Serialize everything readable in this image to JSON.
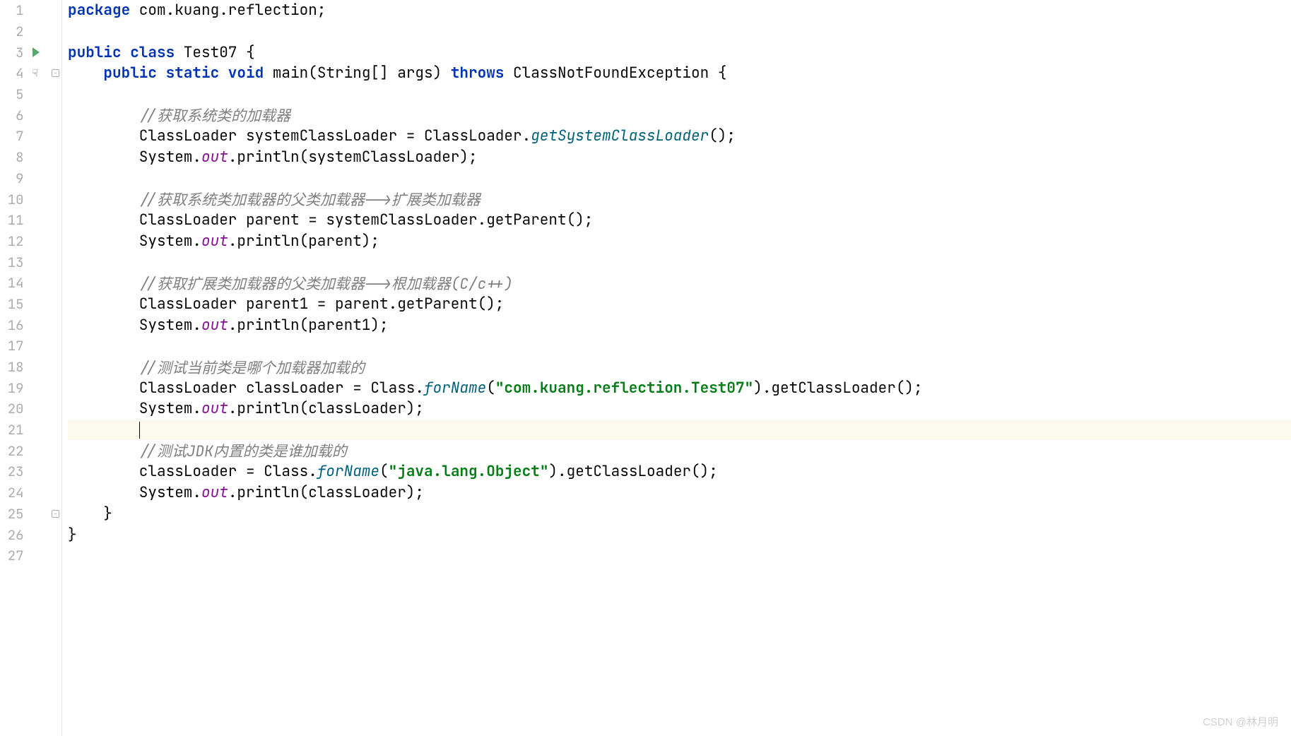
{
  "watermark": "CSDN @林月明",
  "lines": [
    {
      "num": "1",
      "icons": [],
      "tokens": [
        {
          "cls": "kw",
          "t": "package"
        },
        {
          "cls": "plain",
          "t": " com.kuang.reflection;"
        }
      ]
    },
    {
      "num": "2",
      "icons": [],
      "tokens": []
    },
    {
      "num": "3",
      "icons": [
        "run"
      ],
      "tokens": [
        {
          "cls": "kw",
          "t": "public class"
        },
        {
          "cls": "plain",
          "t": " Test07 {"
        }
      ]
    },
    {
      "num": "4",
      "icons": [
        "cursor",
        "fold"
      ],
      "tokens": [
        {
          "cls": "plain",
          "t": "    "
        },
        {
          "cls": "kw",
          "t": "public static void"
        },
        {
          "cls": "plain",
          "t": " main(String[] args) "
        },
        {
          "cls": "kw",
          "t": "throws"
        },
        {
          "cls": "plain",
          "t": " ClassNotFoundException {"
        }
      ]
    },
    {
      "num": "5",
      "icons": [],
      "tokens": []
    },
    {
      "num": "6",
      "icons": [],
      "tokens": [
        {
          "cls": "plain",
          "t": "        "
        },
        {
          "cls": "comment-text",
          "t": "//获取系统类的加载器"
        }
      ]
    },
    {
      "num": "7",
      "icons": [],
      "tokens": [
        {
          "cls": "plain",
          "t": "        ClassLoader systemClassLoader = ClassLoader."
        },
        {
          "cls": "method-static",
          "t": "getSystemClassLoader"
        },
        {
          "cls": "plain",
          "t": "();"
        }
      ]
    },
    {
      "num": "8",
      "icons": [],
      "tokens": [
        {
          "cls": "plain",
          "t": "        System."
        },
        {
          "cls": "field",
          "t": "out"
        },
        {
          "cls": "plain",
          "t": ".println(systemClassLoader);"
        }
      ]
    },
    {
      "num": "9",
      "icons": [],
      "tokens": []
    },
    {
      "num": "10",
      "icons": [],
      "tokens": [
        {
          "cls": "plain",
          "t": "        "
        },
        {
          "cls": "comment-text",
          "t": "//获取系统类加载器的父类加载器-->扩展类加载器"
        }
      ]
    },
    {
      "num": "11",
      "icons": [],
      "tokens": [
        {
          "cls": "plain",
          "t": "        ClassLoader parent = systemClassLoader.getParent();"
        }
      ]
    },
    {
      "num": "12",
      "icons": [],
      "tokens": [
        {
          "cls": "plain",
          "t": "        System."
        },
        {
          "cls": "field",
          "t": "out"
        },
        {
          "cls": "plain",
          "t": ".println(parent);"
        }
      ]
    },
    {
      "num": "13",
      "icons": [],
      "tokens": []
    },
    {
      "num": "14",
      "icons": [],
      "tokens": [
        {
          "cls": "plain",
          "t": "        "
        },
        {
          "cls": "comment-text",
          "t": "//获取扩展类加载器的父类加载器-->根加载器(C/c++)"
        }
      ]
    },
    {
      "num": "15",
      "icons": [],
      "tokens": [
        {
          "cls": "plain",
          "t": "        ClassLoader parent1 = parent.getParent();"
        }
      ]
    },
    {
      "num": "16",
      "icons": [],
      "tokens": [
        {
          "cls": "plain",
          "t": "        System."
        },
        {
          "cls": "field",
          "t": "out"
        },
        {
          "cls": "plain",
          "t": ".println(parent1);"
        }
      ]
    },
    {
      "num": "17",
      "icons": [],
      "tokens": []
    },
    {
      "num": "18",
      "icons": [],
      "tokens": [
        {
          "cls": "plain",
          "t": "        "
        },
        {
          "cls": "comment-text",
          "t": "//测试当前类是哪个加载器加载的"
        }
      ]
    },
    {
      "num": "19",
      "icons": [],
      "tokens": [
        {
          "cls": "plain",
          "t": "        ClassLoader classLoader = Class."
        },
        {
          "cls": "method-static",
          "t": "forName"
        },
        {
          "cls": "plain",
          "t": "("
        },
        {
          "cls": "string",
          "t": "\"com.kuang.reflection.Test07\""
        },
        {
          "cls": "plain",
          "t": ").getClassLoader();"
        }
      ]
    },
    {
      "num": "20",
      "icons": [],
      "tokens": [
        {
          "cls": "plain",
          "t": "        System."
        },
        {
          "cls": "field",
          "t": "out"
        },
        {
          "cls": "plain",
          "t": ".println(classLoader);"
        }
      ]
    },
    {
      "num": "21",
      "icons": [],
      "highlighted": true,
      "tokens": [
        {
          "cls": "plain",
          "t": "        "
        },
        {
          "cls": "caret",
          "t": ""
        }
      ]
    },
    {
      "num": "22",
      "icons": [],
      "tokens": [
        {
          "cls": "plain",
          "t": "        "
        },
        {
          "cls": "comment-text",
          "t": "//测试JDK内置的类是谁加载的"
        }
      ]
    },
    {
      "num": "23",
      "icons": [],
      "tokens": [
        {
          "cls": "plain",
          "t": "        classLoader = Class."
        },
        {
          "cls": "method-static",
          "t": "forName"
        },
        {
          "cls": "plain",
          "t": "("
        },
        {
          "cls": "string",
          "t": "\"java.lang.Object\""
        },
        {
          "cls": "plain",
          "t": ").getClassLoader();"
        }
      ]
    },
    {
      "num": "24",
      "icons": [],
      "tokens": [
        {
          "cls": "plain",
          "t": "        System."
        },
        {
          "cls": "field",
          "t": "out"
        },
        {
          "cls": "plain",
          "t": ".println(classLoader);"
        }
      ]
    },
    {
      "num": "25",
      "icons": [
        "fold"
      ],
      "tokens": [
        {
          "cls": "plain",
          "t": "    }"
        }
      ]
    },
    {
      "num": "26",
      "icons": [],
      "tokens": [
        {
          "cls": "plain",
          "t": "}"
        }
      ]
    },
    {
      "num": "27",
      "icons": [],
      "tokens": []
    }
  ]
}
